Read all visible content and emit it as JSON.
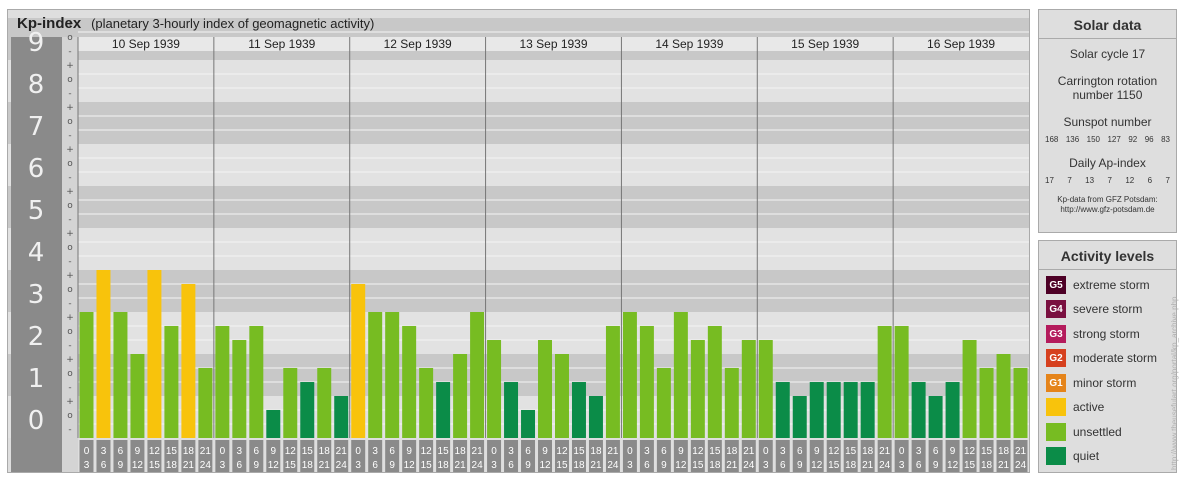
{
  "header": {
    "title": "Kp-index",
    "subtitle": "(planetary 3-hourly index of geomagnetic activity)"
  },
  "solar": {
    "title": "Solar data",
    "cycle": "Solar cycle 17",
    "carrington_1": "Carrington rotation",
    "carrington_2": "number 1150",
    "sunspot_title": "Sunspot number",
    "sunspots": [
      "168",
      "136",
      "150",
      "127",
      "92",
      "96",
      "83"
    ],
    "ap_title": "Daily Ap-index",
    "ap": [
      "17",
      "7",
      "13",
      "7",
      "12",
      "6",
      "7"
    ],
    "credit_1": "Kp-data from  GFZ Potsdam:",
    "credit_2": "http://www.gfz-potsdam.de"
  },
  "levels": {
    "title": "Activity levels",
    "items": [
      {
        "code": "G5",
        "label": "extreme storm",
        "color": "#4d0026"
      },
      {
        "code": "G4",
        "label": "severe storm",
        "color": "#7a1040"
      },
      {
        "code": "G3",
        "label": "strong storm",
        "color": "#b41b5c"
      },
      {
        "code": "G2",
        "label": "moderate storm",
        "color": "#d6401e"
      },
      {
        "code": "G1",
        "label": "minor storm",
        "color": "#e5841a"
      },
      {
        "code": "",
        "label": "active",
        "color": "#f8c30c"
      },
      {
        "code": "",
        "label": "unsettled",
        "color": "#77bc22"
      },
      {
        "code": "",
        "label": "quiet",
        "color": "#0b8c48"
      }
    ]
  },
  "watermark": "http://www.theusefulart.org/portal/kp_archive.php",
  "chart_data": {
    "type": "bar",
    "y_ticks": [
      "0",
      "1",
      "2",
      "3",
      "4",
      "5",
      "6",
      "7",
      "8",
      "9"
    ],
    "sub_ticks": [
      "+",
      "o",
      "-"
    ],
    "ylim": [
      0,
      9
    ],
    "days": [
      "10 Sep 1939",
      "11 Sep 1939",
      "12 Sep 1939",
      "13 Sep 1939",
      "14 Sep 1939",
      "15 Sep 1939",
      "16 Sep 1939"
    ],
    "hour_top": [
      "0",
      "3",
      "6",
      "9",
      "12",
      "15",
      "18",
      "21"
    ],
    "hour_bottom": [
      "3",
      "6",
      "9",
      "12",
      "15",
      "18",
      "21",
      "24"
    ],
    "values": [
      [
        3.0,
        4.0,
        3.0,
        2.0,
        4.0,
        2.667,
        3.667,
        1.667
      ],
      [
        2.667,
        2.333,
        2.667,
        0.667,
        1.667,
        1.333,
        1.667,
        1.0
      ],
      [
        3.667,
        3.0,
        3.0,
        2.667,
        1.667,
        1.333,
        2.0,
        3.0
      ],
      [
        2.333,
        1.333,
        0.667,
        2.333,
        2.0,
        1.333,
        1.0,
        2.667
      ],
      [
        3.0,
        2.667,
        1.667,
        3.0,
        2.333,
        2.667,
        1.667,
        2.333
      ],
      [
        2.333,
        1.333,
        1.0,
        1.333,
        1.333,
        1.333,
        1.333,
        2.667
      ],
      [
        2.667,
        1.333,
        1.0,
        1.333,
        2.333,
        1.667,
        2.0,
        1.667
      ]
    ],
    "thresholds": {
      "quiet_below": 1.5,
      "active_from": 3.5
    },
    "colors": {
      "quiet": "#0b8c48",
      "unsettled": "#77bc22",
      "active": "#f8c30c",
      "band_dark": "#c8c8c8",
      "band_light": "#e2e2e2",
      "tick_box": "#8a8a8a"
    }
  }
}
